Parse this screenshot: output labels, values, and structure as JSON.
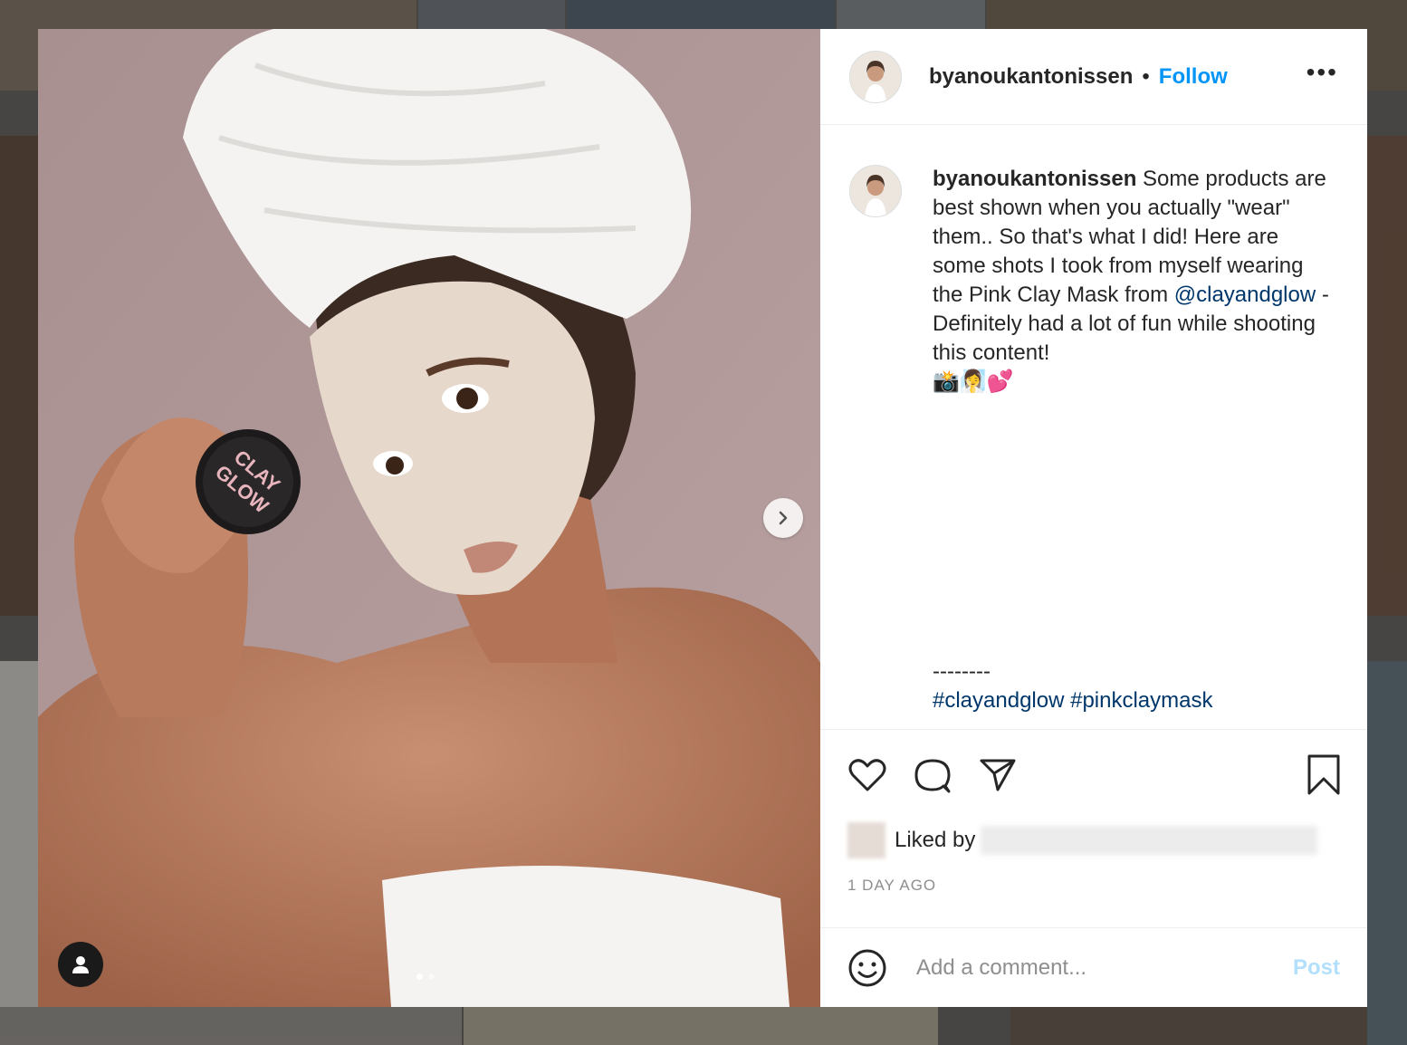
{
  "post": {
    "username": "byanoukantonissen",
    "separator": "•",
    "follow_label": "Follow",
    "more_label": "•••"
  },
  "caption": {
    "username": "byanoukantonissen",
    "text_part1": " Some products are best shown when you actually \"wear\" them.. So that's what I did! Here are some shots I took from myself wearing the Pink Clay Mask from ",
    "mention": "@clayandglow",
    "text_part2": " - Definitely had a lot of fun while shooting this content!",
    "emojis": "📸🧖‍♀️💕",
    "divider": "--------",
    "hashtags": "#clayandglow #pinkclaymask"
  },
  "likes": {
    "prefix": "Liked by"
  },
  "timestamp": "1 DAY AGO",
  "comment": {
    "placeholder": "Add a comment...",
    "post_label": "Post"
  },
  "carousel": {
    "current": 1,
    "total": 2
  },
  "colors": {
    "link": "#0095f6",
    "mention": "#00376b",
    "post_disabled": "#b2dffc"
  }
}
